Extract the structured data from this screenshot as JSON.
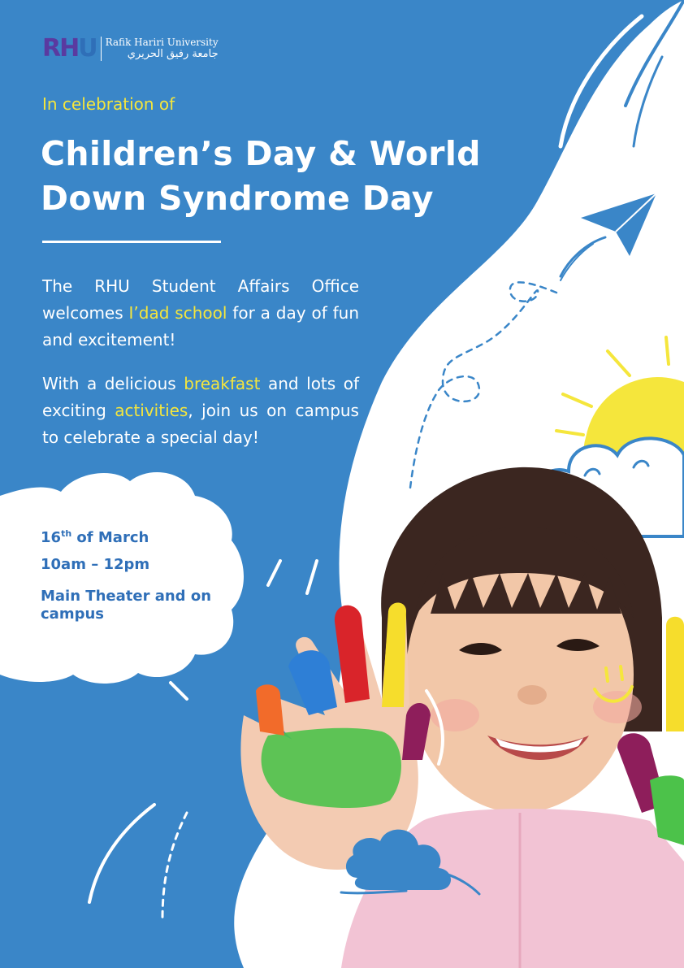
{
  "logo": {
    "mark_letters": "RH",
    "mark_u": "U",
    "name_en": "Rafik Hariri University",
    "name_ar": "جامعة رفيق الحريري"
  },
  "kicker": "In celebration of",
  "title": {
    "line1": "Children’s Day & World",
    "line2": "Down Syndrome Day"
  },
  "paragraph1": {
    "part1": "The RHU Student Affairs Office welcomes ",
    "highlight": "I’dad school",
    "part2": " for a day of fun and excitement!"
  },
  "paragraph2": {
    "part1": "With a delicious ",
    "highlight1": "breakfast",
    "part2": " and lots of exciting ",
    "highlight2": "activities",
    "part3": ", join us on campus to celebrate a special day!"
  },
  "event": {
    "date_day": "16",
    "date_sup": "th",
    "date_rest": " of March",
    "time": "10am – 12pm",
    "venue": "Main Theater and on campus"
  },
  "colors": {
    "background_blue": "#3a86c8",
    "accent_yellow": "#f5e63c",
    "white": "#ffffff",
    "info_text_blue": "#2f6fb8"
  },
  "illustrations": [
    "paper-plane-icon",
    "sun-icon",
    "cloud-icon",
    "smiley-icon",
    "child-photo"
  ]
}
